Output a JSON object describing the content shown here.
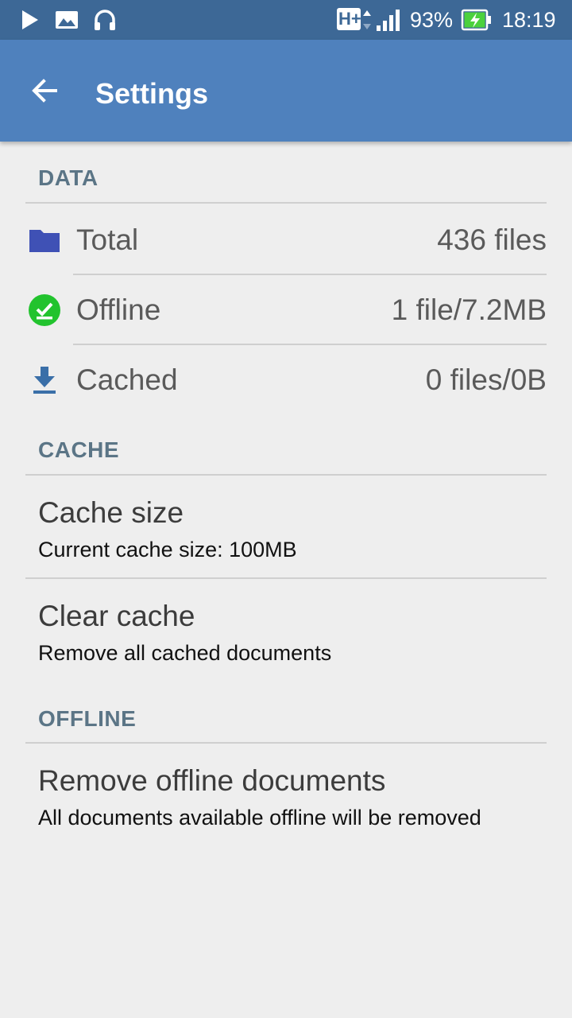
{
  "status_bar": {
    "network_type": "H+",
    "battery_percent": "93%",
    "time": "18:19",
    "icons": [
      "play-icon",
      "image-icon",
      "headset-icon",
      "hplus-icon",
      "signal-icon",
      "battery-charging-icon"
    ]
  },
  "app_bar": {
    "back_icon": "arrow-left-icon",
    "title": "Settings"
  },
  "sections": {
    "data": {
      "header": "DATA",
      "rows": [
        {
          "icon": "folder-icon",
          "label": "Total",
          "value": "436 files"
        },
        {
          "icon": "offline-check-icon",
          "label": "Offline",
          "value": "1 file/7.2MB"
        },
        {
          "icon": "download-icon",
          "label": "Cached",
          "value": "0 files/0B"
        }
      ]
    },
    "cache": {
      "header": "CACHE",
      "items": [
        {
          "title": "Cache size",
          "summary": "Current cache size: 100MB"
        },
        {
          "title": "Clear cache",
          "summary": "Remove all cached documents"
        }
      ]
    },
    "offline": {
      "header": "OFFLINE",
      "items": [
        {
          "title": "Remove offline documents",
          "summary": "All documents available offline will be removed"
        }
      ]
    }
  },
  "colors": {
    "status_bar": "#3d6896",
    "app_bar": "#4f81bd",
    "background": "#eeeeee",
    "section_header": "#5b7586",
    "folder": "#3f51b5",
    "offline_green": "#22c32e",
    "download_blue": "#3a6fa8"
  }
}
